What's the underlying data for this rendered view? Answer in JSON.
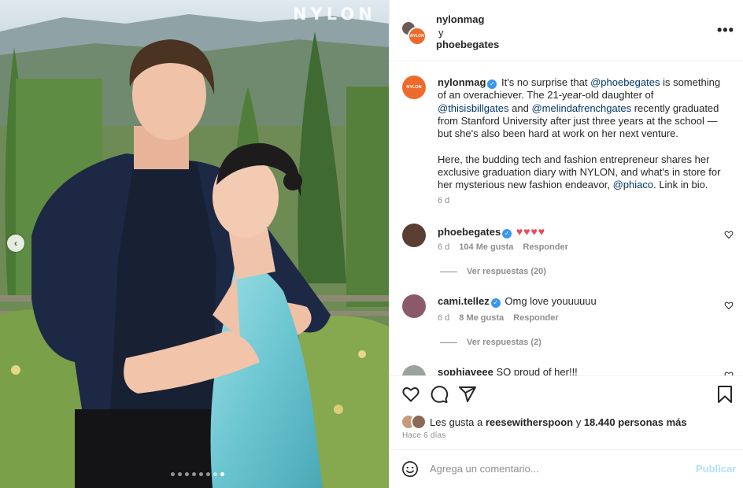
{
  "photo": {
    "watermark": "NYLON",
    "slide_count": 8,
    "active_slide": 8,
    "prev_icon": "chevron-left-icon"
  },
  "header": {
    "account1": "nylonmag",
    "joiner": "y",
    "account2": "phoebegates",
    "avatar1_text": "NYLON",
    "more_icon": "more-horizontal-icon",
    "more_label": "•••"
  },
  "caption": {
    "avatar_text": "NYLON",
    "username": "nylonmag",
    "seg1": "It's no surprise that ",
    "mention1": "@phoebegates",
    "seg2": " is something of an overachiever. The 21-year-old daughter of ",
    "mention2": "@thisisbillgates",
    "seg3": " and ",
    "mention3": "@melindafrenchgates",
    "seg4": " recently graduated from Stanford University after just three years at the school — but she's also been hard at work on her next venture.",
    "seg5": "Here, the budding tech and fashion entrepreneur shares her exclusive graduation diary with NYLON, and what's in store for her mysterious new fashion endeavor, ",
    "mention4": "@phiaco",
    "seg6": ". Link in bio.",
    "time": "6 d"
  },
  "comments": [
    {
      "username": "phoebegates",
      "text": "♥♥♥♥",
      "time": "6 d",
      "likes": "104 Me gusta",
      "reply": "Responder",
      "view_replies": "Ver respuestas (20)",
      "avatar_color": "#5a3e34"
    },
    {
      "username": "cami.tellez",
      "text": "Omg love youuuuuu",
      "time": "6 d",
      "likes": "8 Me gusta",
      "reply": "Responder",
      "view_replies": "Ver respuestas (2)",
      "avatar_color": "#8a5a6b"
    },
    {
      "username": "sophiaveee",
      "text": "SO proud of her!!!",
      "avatar_color": "#9aa39c"
    }
  ],
  "actions": {
    "like_icon": "heart-outline-icon",
    "comment_icon": "comment-icon",
    "share_icon": "paper-plane-icon",
    "save_icon": "bookmark-icon",
    "likes_prefix": "Les gusta a ",
    "likes_user": "reesewitherspoon",
    "likes_mid": " y ",
    "likes_count": "18.440 personas más",
    "post_time": "Hace 6 días"
  },
  "add_comment": {
    "emoji_icon": "smile-icon",
    "placeholder": "Agrega un comentario...",
    "publish_label": "Publicar"
  },
  "colors": {
    "brand_orange": "#ee6a2c",
    "verified_blue": "#3897f0",
    "mention_blue": "#00376b",
    "heart_red": "#ed4956",
    "muted": "#8e8e8e",
    "publish_disabled": "#b2dffc"
  }
}
